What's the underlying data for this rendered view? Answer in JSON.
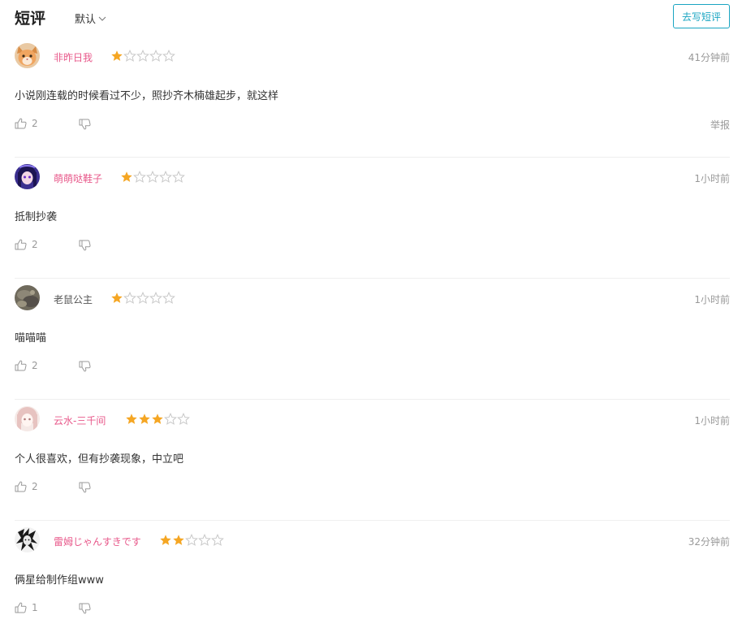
{
  "header": {
    "title": "短评",
    "sort_label": "默认",
    "write_button": "去写短评"
  },
  "colors": {
    "accent": "#1aa5c2",
    "username": "#e8598b",
    "star_filled": "#f5a623",
    "star_empty": "#c8c8c8",
    "meta_text": "#999999"
  },
  "reviews": [
    {
      "username": "非昨日我",
      "rating": 1,
      "time": "41分钟前",
      "content": "小说刚连载的时候看过不少，照抄齐木楠雄起步，就这样",
      "likes": "2",
      "report": "举报",
      "avatar_icon": "cat-avatar"
    },
    {
      "username": "萌萌哒鞋子",
      "rating": 1,
      "time": "1小时前",
      "content": "抵制抄袭",
      "likes": "2",
      "avatar_icon": "anime-girl-avatar"
    },
    {
      "username": "老鼠公主",
      "rating": 1,
      "time": "1小时前",
      "content": "喵喵喵",
      "likes": "2",
      "avatar_icon": "photo-avatar"
    },
    {
      "username": "云水-三千间",
      "rating": 3,
      "time": "1小时前",
      "content": "个人很喜欢，但有抄袭现象，中立吧",
      "likes": "2",
      "avatar_icon": "anime-avatar"
    },
    {
      "username": "雷姆じゃんすきです",
      "rating": 2,
      "time": "32分钟前",
      "content": "俩星给制作组www",
      "likes": "1",
      "avatar_icon": "monochrome-avatar"
    }
  ]
}
